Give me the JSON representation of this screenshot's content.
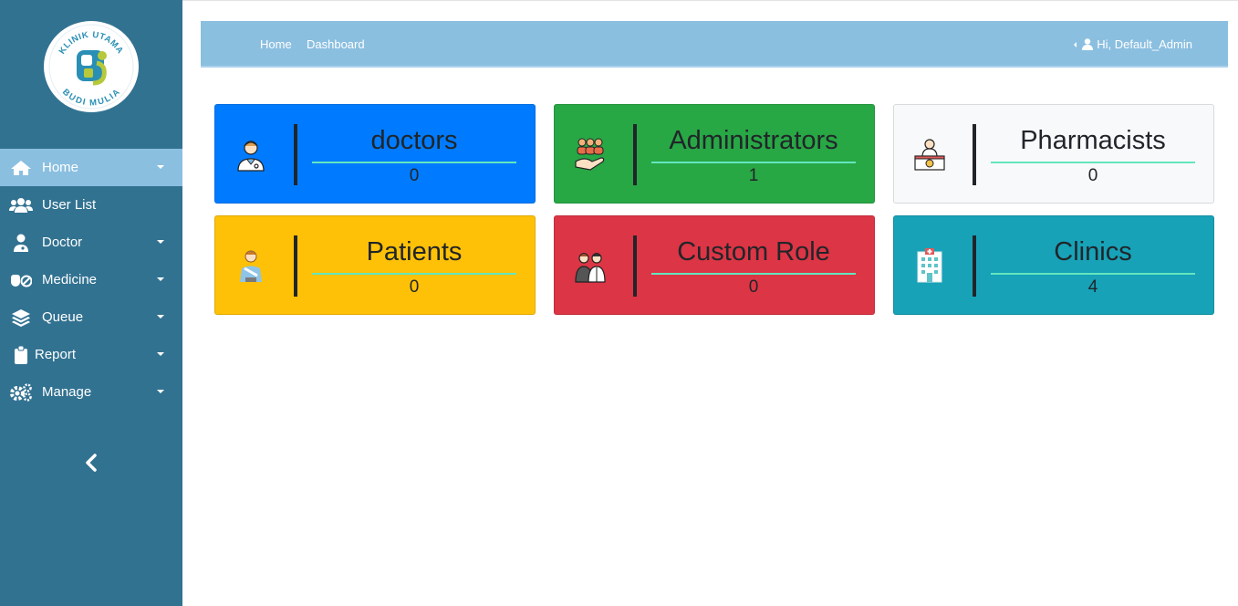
{
  "logo": {
    "top_text": "KLINIK UTAMA",
    "bottom_text": "BUDI MULIA"
  },
  "sidebar": {
    "items": [
      {
        "label": "Home",
        "icon": "home-icon",
        "active": true,
        "has_caret": true
      },
      {
        "label": "User List",
        "icon": "users-icon",
        "active": false,
        "has_caret": false
      },
      {
        "label": "Doctor",
        "icon": "doctor-icon",
        "active": false,
        "has_caret": true
      },
      {
        "label": "Medicine",
        "icon": "pills-icon",
        "active": false,
        "has_caret": true
      },
      {
        "label": "Queue",
        "icon": "layers-icon",
        "active": false,
        "has_caret": true
      },
      {
        "label": "Report",
        "icon": "clipboard-icon",
        "active": false,
        "has_caret": true
      },
      {
        "label": "Manage",
        "icon": "gears-icon",
        "active": false,
        "has_caret": true
      }
    ],
    "collapse_icon": "chevron-left-icon"
  },
  "navbar": {
    "breadcrumb": [
      "Home",
      "Dashboard"
    ],
    "user_greeting": "Hi, Default_Admin",
    "user_icon": "user-icon"
  },
  "cards": [
    {
      "title": "doctors",
      "value": "0",
      "icon": "doctor-avatar-icon",
      "bg": "#007bff"
    },
    {
      "title": "Administrators",
      "value": "1",
      "icon": "team-hand-icon",
      "bg": "#28a745"
    },
    {
      "title": "Pharmacists",
      "value": "0",
      "icon": "pharmacist-desk-icon",
      "bg": "#f8f9fa"
    },
    {
      "title": "Patients",
      "value": "0",
      "icon": "patient-icon",
      "bg": "#ffc107"
    },
    {
      "title": "Custom Role",
      "value": "0",
      "icon": "people-pair-icon",
      "bg": "#dc3545"
    },
    {
      "title": "Clinics",
      "value": "4",
      "icon": "hospital-building-icon",
      "bg": "#17a2b8"
    }
  ],
  "colors": {
    "sidebar_bg": "#327291",
    "navbar_bg": "#8bbfe0",
    "accent_line": "#63e6be"
  }
}
